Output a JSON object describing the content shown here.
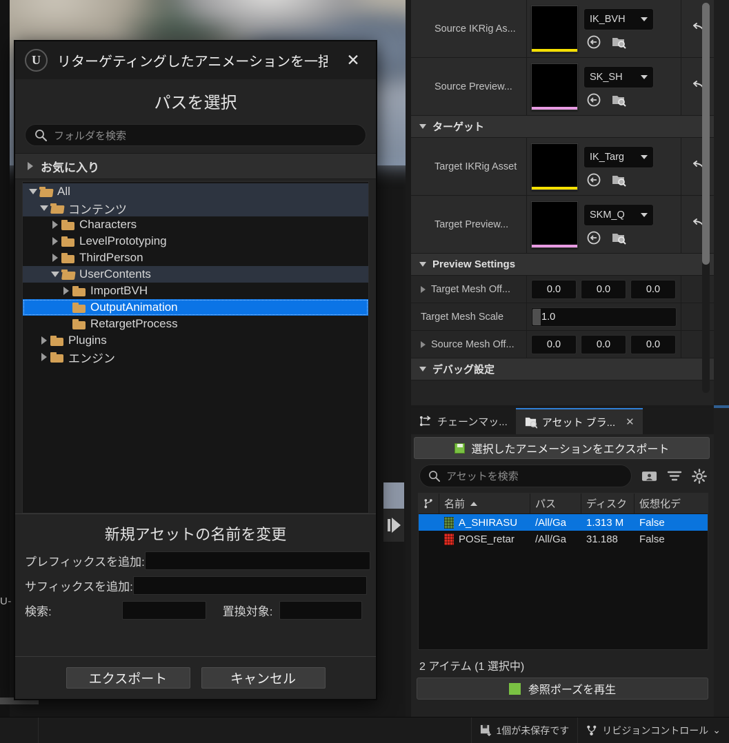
{
  "background": {
    "left_fragment_text": "U-"
  },
  "dialog": {
    "logo": "ue-logo",
    "title": "リターゲティングしたアニメーションを一括エ",
    "close_label": "✕",
    "heading": "パスを選択",
    "search": {
      "placeholder": "フォルダを検索",
      "value": ""
    },
    "favorites_label": "お気に入り",
    "tree": [
      {
        "label": "All",
        "depth": 0,
        "arrow": "down",
        "open_folder": true,
        "state": "expanded"
      },
      {
        "label": "コンテンツ",
        "depth": 1,
        "arrow": "down",
        "open_folder": true,
        "state": "expanded"
      },
      {
        "label": "Characters",
        "depth": 2,
        "arrow": "right",
        "open_folder": false,
        "state": "normal"
      },
      {
        "label": "LevelPrototyping",
        "depth": 2,
        "arrow": "right",
        "open_folder": false,
        "state": "normal"
      },
      {
        "label": "ThirdPerson",
        "depth": 2,
        "arrow": "right",
        "open_folder": false,
        "state": "normal"
      },
      {
        "label": "UserContents",
        "depth": 2,
        "arrow": "down",
        "open_folder": true,
        "state": "expanded"
      },
      {
        "label": "ImportBVH",
        "depth": 3,
        "arrow": "right",
        "open_folder": false,
        "state": "normal"
      },
      {
        "label": "OutputAnimation",
        "depth": 3,
        "arrow": "none",
        "open_folder": false,
        "state": "selected"
      },
      {
        "label": "RetargetProcess",
        "depth": 3,
        "arrow": "none",
        "open_folder": false,
        "state": "normal"
      },
      {
        "label": "Plugins",
        "depth": 1,
        "arrow": "right",
        "open_folder": false,
        "state": "normal"
      },
      {
        "label": "エンジン",
        "depth": 1,
        "arrow": "right",
        "open_folder": false,
        "state": "normal"
      }
    ],
    "rename": {
      "title": "新規アセットの名前を変更",
      "prefix_label": "プレフィックスを追加:",
      "prefix_value": "",
      "suffix_label": "サフィックスを追加:",
      "suffix_value": "",
      "search_label": "検索:",
      "search_value": "",
      "replace_label": "置換対象:",
      "replace_value": ""
    },
    "buttons": {
      "export": "エクスポート",
      "cancel": "キャンセル"
    }
  },
  "details": {
    "rows": [
      {
        "label": "Source IKRig As...",
        "combo": "IK_BVH",
        "underline_color": "#f5e000",
        "reset_icon": "↵"
      },
      {
        "label": "Source Preview...",
        "combo": "SK_SH",
        "underline_color": "#e79ae2",
        "reset_icon": "↵"
      }
    ],
    "target_section": "ターゲット",
    "target_rows": [
      {
        "label": "Target IKRig Asset",
        "combo": "IK_Targ",
        "underline_color": "#f5e000",
        "reset_icon": "↵"
      },
      {
        "label": "Target Preview...",
        "combo": "SKM_Q",
        "underline_color": "#e79ae2",
        "reset_icon": "↵"
      }
    ],
    "preview_section": "Preview Settings",
    "preview_rows": [
      {
        "label": "Target Mesh Off...",
        "type": "vector3",
        "values": [
          "0.0",
          "0.0",
          "0.0"
        ],
        "expandable": true
      },
      {
        "label": "Target Mesh Scale",
        "type": "slider",
        "values": [
          "1.0"
        ],
        "expandable": false
      },
      {
        "label": "Source Mesh Off...",
        "type": "vector3",
        "values": [
          "0.0",
          "0.0",
          "0.0"
        ],
        "expandable": true
      }
    ],
    "debug_section": "デバッグ設定"
  },
  "browser": {
    "tabs": [
      {
        "label": "チェーンマッ...",
        "icon": "chain-mapping-icon",
        "active": false,
        "closable": false
      },
      {
        "label": "アセット ブラ...",
        "icon": "asset-browser-icon",
        "active": true,
        "closable": true,
        "close_label": "✕"
      }
    ],
    "export_button": "選択したアニメーションをエクスポート",
    "search": {
      "placeholder": "アセットを検索",
      "value": ""
    },
    "toolbar_icons": [
      "column-settings-icon",
      "filter-icon",
      "gear-icon"
    ],
    "table": {
      "columns": [
        "",
        "名前",
        "パス",
        "ディスク",
        "仮想化デ"
      ],
      "sort_column": "名前",
      "sort_direction": "asc",
      "rows": [
        {
          "name": "A_SHIRASU",
          "path": "/All/Ga",
          "disk": "1.313 M",
          "virtualized": "False",
          "icon_color": "#5f8a3e",
          "selected": true
        },
        {
          "name": "POSE_retar",
          "path": "/All/Ga",
          "disk": "31.188 ",
          "virtualized": "False",
          "icon_color": "#e02b20",
          "selected": false
        }
      ]
    },
    "item_count": "2 アイテム (1 選択中)",
    "play_pose_button": "参照ポーズを再生"
  },
  "statusbar": {
    "unsaved_label": "1個が未保存です",
    "revision_label": "リビジョンコントロール",
    "revision_chevron": "⌄"
  }
}
